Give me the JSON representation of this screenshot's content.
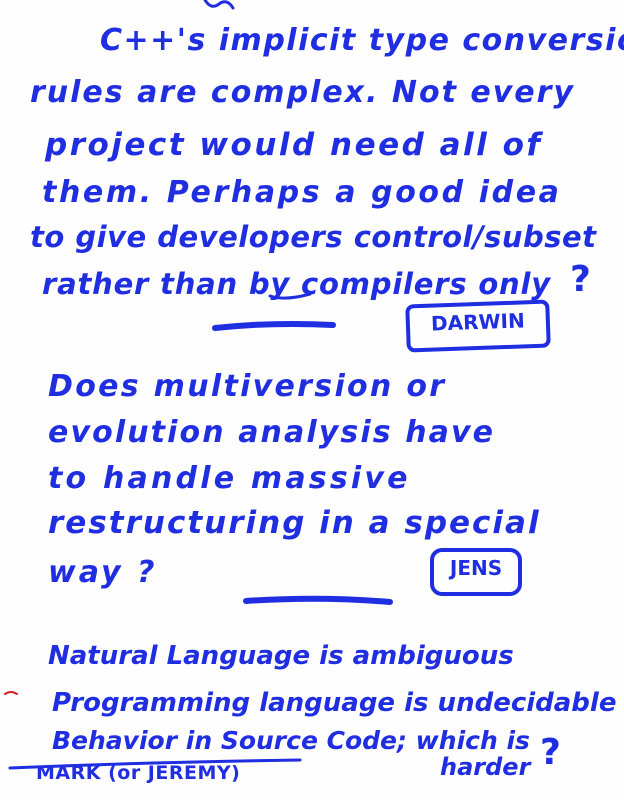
{
  "notes": {
    "note1": {
      "lines": [
        "C++'s implicit type conversion",
        "rules are complex. Not every",
        "project would need all of",
        "them. Perhaps a good idea",
        "to give developers control/subset",
        "rather than by compilers only"
      ],
      "question_mark": "?",
      "tag": "DARWIN"
    },
    "note2": {
      "lines": [
        "Does multiversion or",
        "evolution analysis have",
        "to handle massive",
        "restructuring in a special",
        "way ?"
      ],
      "tag": "JENS"
    },
    "note3": {
      "lines": [
        "Natural Language is ambiguous",
        "Programming language is undecidable",
        "Behavior in Source Code; which is",
        "harder"
      ],
      "question_mark": "?",
      "signature": "MARK (or JEREMY)"
    }
  },
  "colors": {
    "ink": "#1f2ee0",
    "paper": "#fefefe",
    "red_ink": "#d0202a"
  }
}
